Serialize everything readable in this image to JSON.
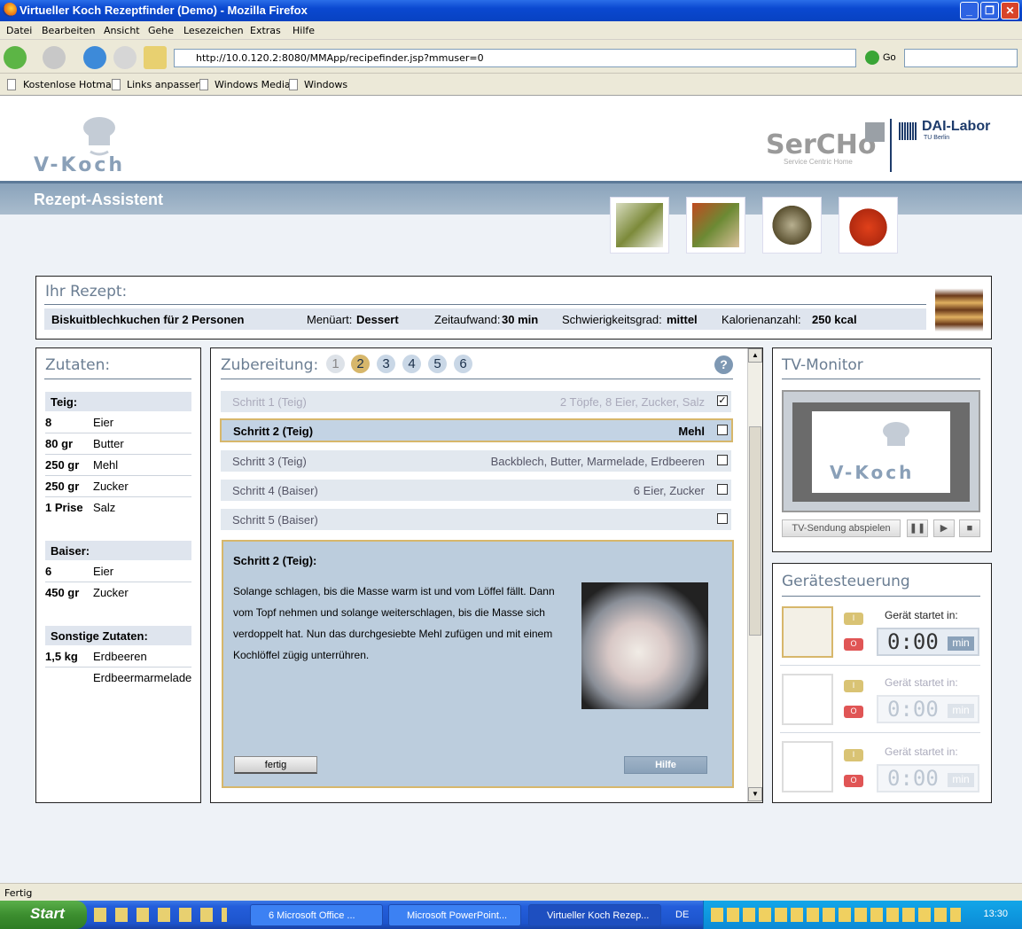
{
  "window": {
    "title": "Virtueller Koch Rezeptfinder (Demo) - Mozilla Firefox",
    "minimize": "_",
    "maximize": "❐",
    "close": "✕"
  },
  "menu": [
    "Datei",
    "Bearbeiten",
    "Ansicht",
    "Gehe",
    "Lesezeichen",
    "Extras",
    "Hilfe"
  ],
  "nav": {
    "url": "http://10.0.120.2:8080/MMApp/recipefinder.jsp?mmuser=0",
    "go_label": "Go"
  },
  "bookmarks": [
    "Kostenlose Hotmail",
    "Links anpassen",
    "Windows Media",
    "Windows"
  ],
  "header": {
    "logo_text": "V-Koch",
    "partner_logo": "SerCHo",
    "partner_sub": "Service Centric Home",
    "lab_logo": "DAI-Labor",
    "lab_sub": "TU Berlin"
  },
  "band_title": "Rezept-Assistent",
  "recipe": {
    "section_title": "Ihr Rezept:",
    "name": "Biskuitblechkuchen für 2 Personen",
    "menuart_label": "Menüart:",
    "menuart": "Dessert",
    "zeit_label": "Zeitaufwand:",
    "zeit": "30 min",
    "schwierig_label": "Schwierigkeitsgrad:",
    "schwierig": "mittel",
    "kalorien_label": "Kalorienanzahl:",
    "kalorien": "250 kcal"
  },
  "zutaten": {
    "title": "Zutaten:",
    "groups": [
      {
        "name": "Teig:",
        "items": [
          {
            "amount": "8",
            "item": "Eier"
          },
          {
            "amount": "80 gr",
            "item": "Butter"
          },
          {
            "amount": "250 gr",
            "item": "Mehl"
          },
          {
            "amount": "250 gr",
            "item": "Zucker"
          },
          {
            "amount": "1 Prise",
            "item": "Salz"
          }
        ]
      },
      {
        "name": "Baiser:",
        "items": [
          {
            "amount": "6",
            "item": "Eier"
          },
          {
            "amount": "450 gr",
            "item": "Zucker"
          }
        ]
      },
      {
        "name": "Sonstige Zutaten:",
        "items": [
          {
            "amount": "1,5 kg",
            "item": "Erdbeeren"
          },
          {
            "amount": "",
            "item": "Erdbeermarmelade"
          }
        ]
      }
    ]
  },
  "zubereitung": {
    "title": "Zubereitung:",
    "step_numbers": [
      "1",
      "2",
      "3",
      "4",
      "5",
      "6"
    ],
    "help_icon": "?",
    "steps": [
      {
        "label": "Schritt 1 (Teig)",
        "ingredients": "2 Töpfe, 8 Eier, Zucker, Salz",
        "check": "✓"
      },
      {
        "label": "Schritt 2 (Teig)",
        "ingredients": "Mehl",
        "check": ""
      },
      {
        "label": "Schritt 3 (Teig)",
        "ingredients": "Backblech, Butter, Marmelade, Erdbeeren",
        "check": ""
      },
      {
        "label": "Schritt 4 (Baiser)",
        "ingredients": "6 Eier, Zucker",
        "check": ""
      },
      {
        "label": "Schritt 5 (Baiser)",
        "ingredients": "",
        "check": ""
      }
    ],
    "detail_title": "Schritt 2 (Teig):",
    "detail_text": "Solange schlagen, bis die Masse warm ist und vom Löffel fällt. Dann vom Topf nehmen und solange weiterschlagen, bis die Masse sich verdoppelt hat. Nun das durchgesiebte Mehl zufügen und mit einem Kochlöffel zügig unterrühren.",
    "fertig_label": "fertig",
    "hilfe_label": "Hilfe"
  },
  "tv": {
    "title": "TV-Monitor",
    "logo_text": "V-Koch",
    "play_label": "TV-Sendung abspielen",
    "pause": "❚❚",
    "play": "▶",
    "stop": "■"
  },
  "geraete": {
    "title": "Gerätesteuerung",
    "on_label": "I",
    "off_label": "O",
    "devices": [
      {
        "icon": "mixer-icon",
        "label": "Gerät startet in:",
        "time": "0:00",
        "unit": "min"
      },
      {
        "icon": "oven-icon",
        "label": "Gerät startet in:",
        "time": "0:00",
        "unit": "min"
      },
      {
        "icon": "blender-icon",
        "label": "Gerät startet in:",
        "time": "0:00",
        "unit": "min"
      }
    ]
  },
  "status": "Fertig",
  "taskbar": {
    "start": "Start",
    "tasks": [
      "6 Microsoft Office ...",
      "Microsoft PowerPoint...",
      "Virtueller Koch Rezep..."
    ],
    "lang": "DE",
    "clock": "13:30"
  }
}
